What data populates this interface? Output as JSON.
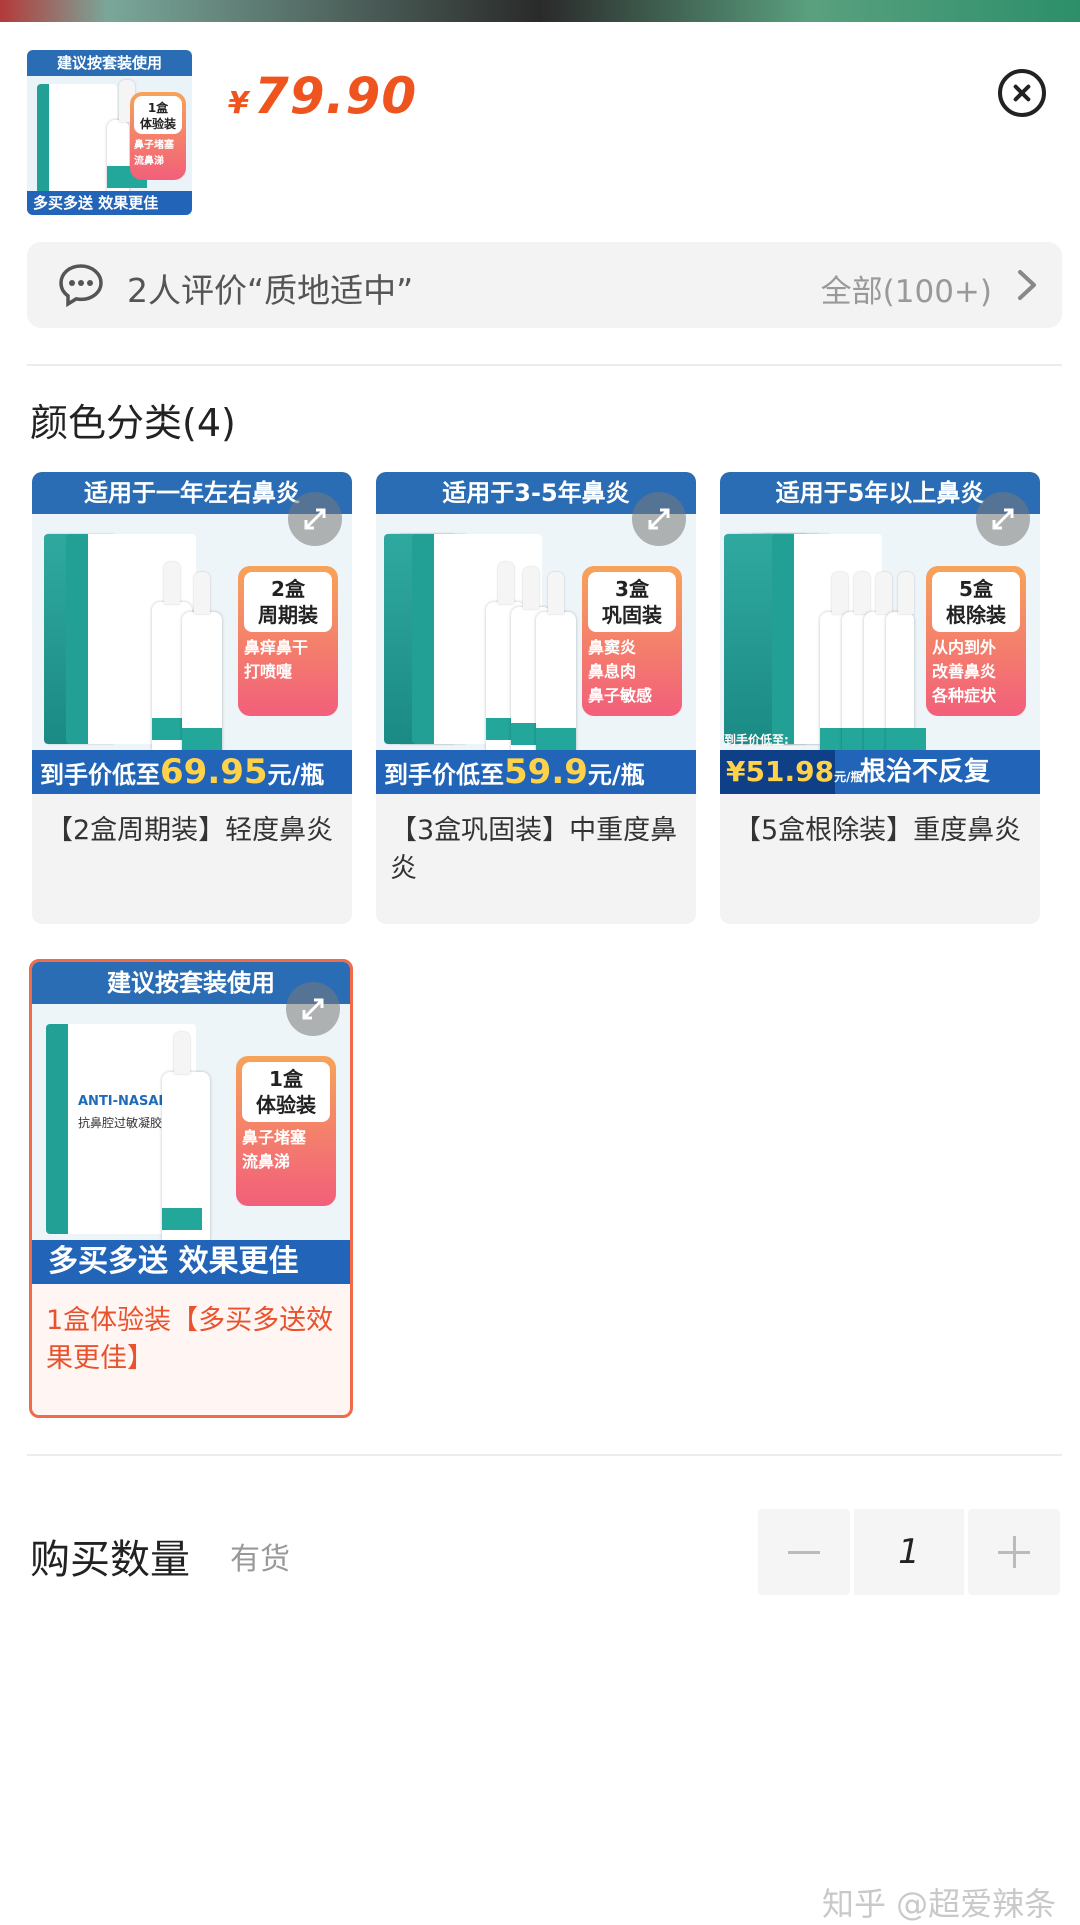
{
  "header": {
    "currency_symbol": "¥",
    "price": "79.90",
    "thumbnail": {
      "banner_top": "建议按套装使用",
      "badge_title": "1盒\n体验装",
      "badge_tags": [
        "鼻子堵塞",
        "流鼻涕"
      ],
      "bottom_text": "多买多送 效果更佳"
    }
  },
  "reviews": {
    "text": "2人评价“质地适中”",
    "all_label": "全部(100+)"
  },
  "variants": {
    "section_title": "颜色分类(4)",
    "items": [
      {
        "banner_top": "适用于一年左右鼻炎",
        "badge_title": "2盒\n周期装",
        "badge_tags": [
          "鼻痒鼻干",
          "打喷嚏"
        ],
        "bottom_prefix": "到手价低至",
        "bottom_price": "69.95",
        "bottom_suffix": "元/瓶",
        "caption": "【2盒周期装】轻度鼻炎",
        "selected": false
      },
      {
        "banner_top": "适用于3-5年鼻炎",
        "badge_title": "3盒\n巩固装",
        "badge_tags": [
          "鼻窦炎",
          "鼻息肉",
          "鼻子敏感"
        ],
        "bottom_prefix": "到手价低至",
        "bottom_price": "59.9",
        "bottom_suffix": "元/瓶",
        "caption": "【3盒巩固装】中重度鼻炎",
        "selected": false
      },
      {
        "banner_top": "适用于5年以上鼻炎",
        "badge_title": "5盒\n根除装",
        "badge_tags": [
          "从内到外",
          "改善鼻炎",
          "各种症状"
        ],
        "bottom_prefix": "到手价低至:",
        "bottom_price": "¥51.98",
        "bottom_suffix": "元/瓶",
        "bottom_right": "根治不反复",
        "caption": "【5盒根除装】重度鼻炎",
        "selected": false
      },
      {
        "banner_top": "建议按套装使用",
        "badge_title": "1盒\n体验装",
        "badge_tags": [
          "鼻子堵塞",
          "流鼻涕"
        ],
        "product_name": "ANTI-NASAL",
        "product_cn": "抗鼻腔过敏凝胶",
        "bottom_text": "多买多送 效果更佳",
        "caption": "1盒体验装【多买多送效果更佳】",
        "selected": true
      }
    ]
  },
  "quantity": {
    "label": "购买数量",
    "stock": "有货",
    "value": "1"
  },
  "watermark": "知乎 @超爱辣条",
  "colors": {
    "price": "#f0541e",
    "selected_border": "#ef6b4a",
    "banner_blue": "#2b6db5",
    "teal": "#22a095"
  }
}
